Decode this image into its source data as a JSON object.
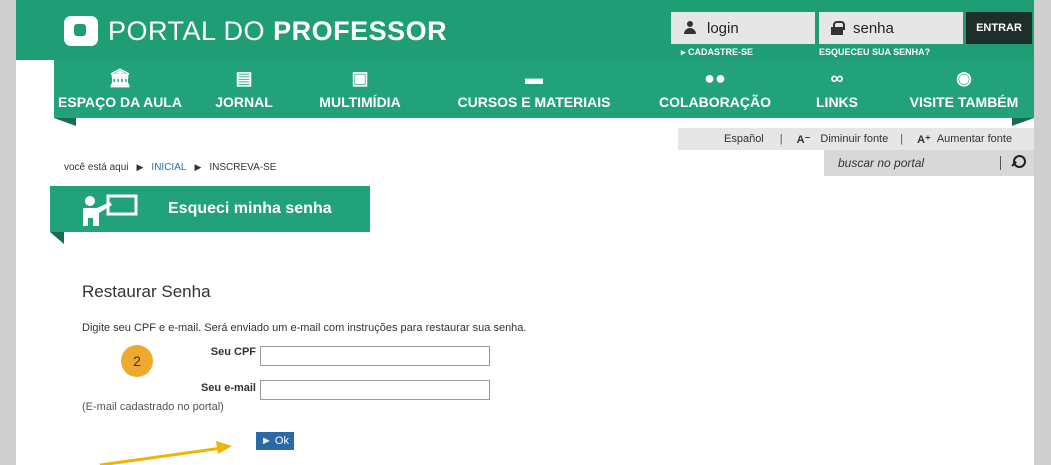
{
  "header": {
    "logo_prefix": "PORTAL DO",
    "logo_bold": "PROFESSOR",
    "login_placeholder": "login",
    "password_placeholder": "senha",
    "enter_label": "ENTRAR",
    "cadastre_label": "CADASTRE-SE",
    "forgot_label": "ESQUECEU SUA SENHA?"
  },
  "nav": {
    "items": [
      {
        "label": "ESPAÇO DA AULA",
        "icon": "building-icon"
      },
      {
        "label": "JORNAL",
        "icon": "newspaper-icon"
      },
      {
        "label": "MULTIMÍDIA",
        "icon": "play-icon"
      },
      {
        "label": "CURSOS E MATERIAIS",
        "icon": "folder-icon"
      },
      {
        "label": "COLABORAÇÃO",
        "icon": "people-icon"
      },
      {
        "label": "LINKS",
        "icon": "link-icon"
      },
      {
        "label": "VISITE TAMBÉM",
        "icon": "eye-icon"
      }
    ]
  },
  "tools": {
    "language": "Español",
    "decrease_symbol": "A⁻",
    "decrease_label": "Diminuir fonte",
    "increase_symbol": "A⁺",
    "increase_label": "Aumentar fonte",
    "search_placeholder": "buscar no portal"
  },
  "breadcrumb": {
    "prefix": "você está aqui",
    "items": [
      "INICIAL",
      "INSCREVA-SE"
    ]
  },
  "banner": {
    "title": "Esqueci minha senha"
  },
  "form": {
    "title": "Restaurar Senha",
    "description": "Digite seu CPF e e-mail. Será enviado um e-mail com instruções para restaurar sua senha.",
    "cpf_label": "Seu CPF",
    "cpf_value": "",
    "email_label": "Seu e-mail",
    "email_value": "",
    "email_hint": "(E-mail cadastrado no portal)",
    "submit_label": "Ok"
  },
  "annotation": {
    "step_number": "2",
    "badge_color": "#efaa2e",
    "arrow_color": "#f0b500"
  },
  "colors": {
    "brand_green": "#1f9e76",
    "dark_green": "#1b6a52",
    "button_blue": "#2b68a8"
  }
}
